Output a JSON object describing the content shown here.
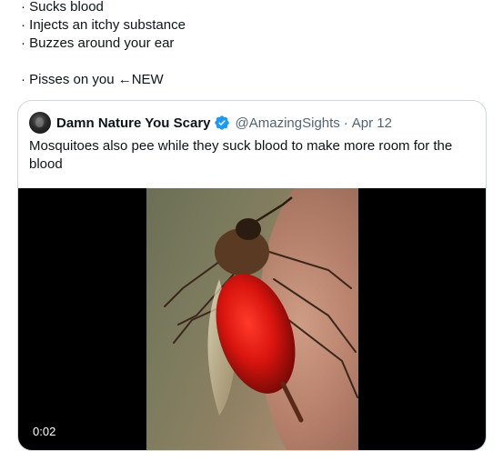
{
  "tweet": {
    "lines": [
      "· Sucks blood",
      "· Injects an itchy substance",
      "· Buzzes around your ear",
      "",
      "· Pisses on you ←NEW"
    ]
  },
  "quote": {
    "author_name": "Damn Nature You Scary",
    "handle": "@AmazingSights",
    "separator": "·",
    "date": "Apr 12",
    "text": "Mosquitoes also pee while they suck blood to make more room for the blood",
    "avatar_icon": "skull-avatar",
    "verified_icon": "verified-badge-icon",
    "verified_color": "#1d9bf0",
    "media": {
      "type": "video",
      "duration": "0:02",
      "image_description": "mosquito-feeding-on-skin"
    }
  }
}
